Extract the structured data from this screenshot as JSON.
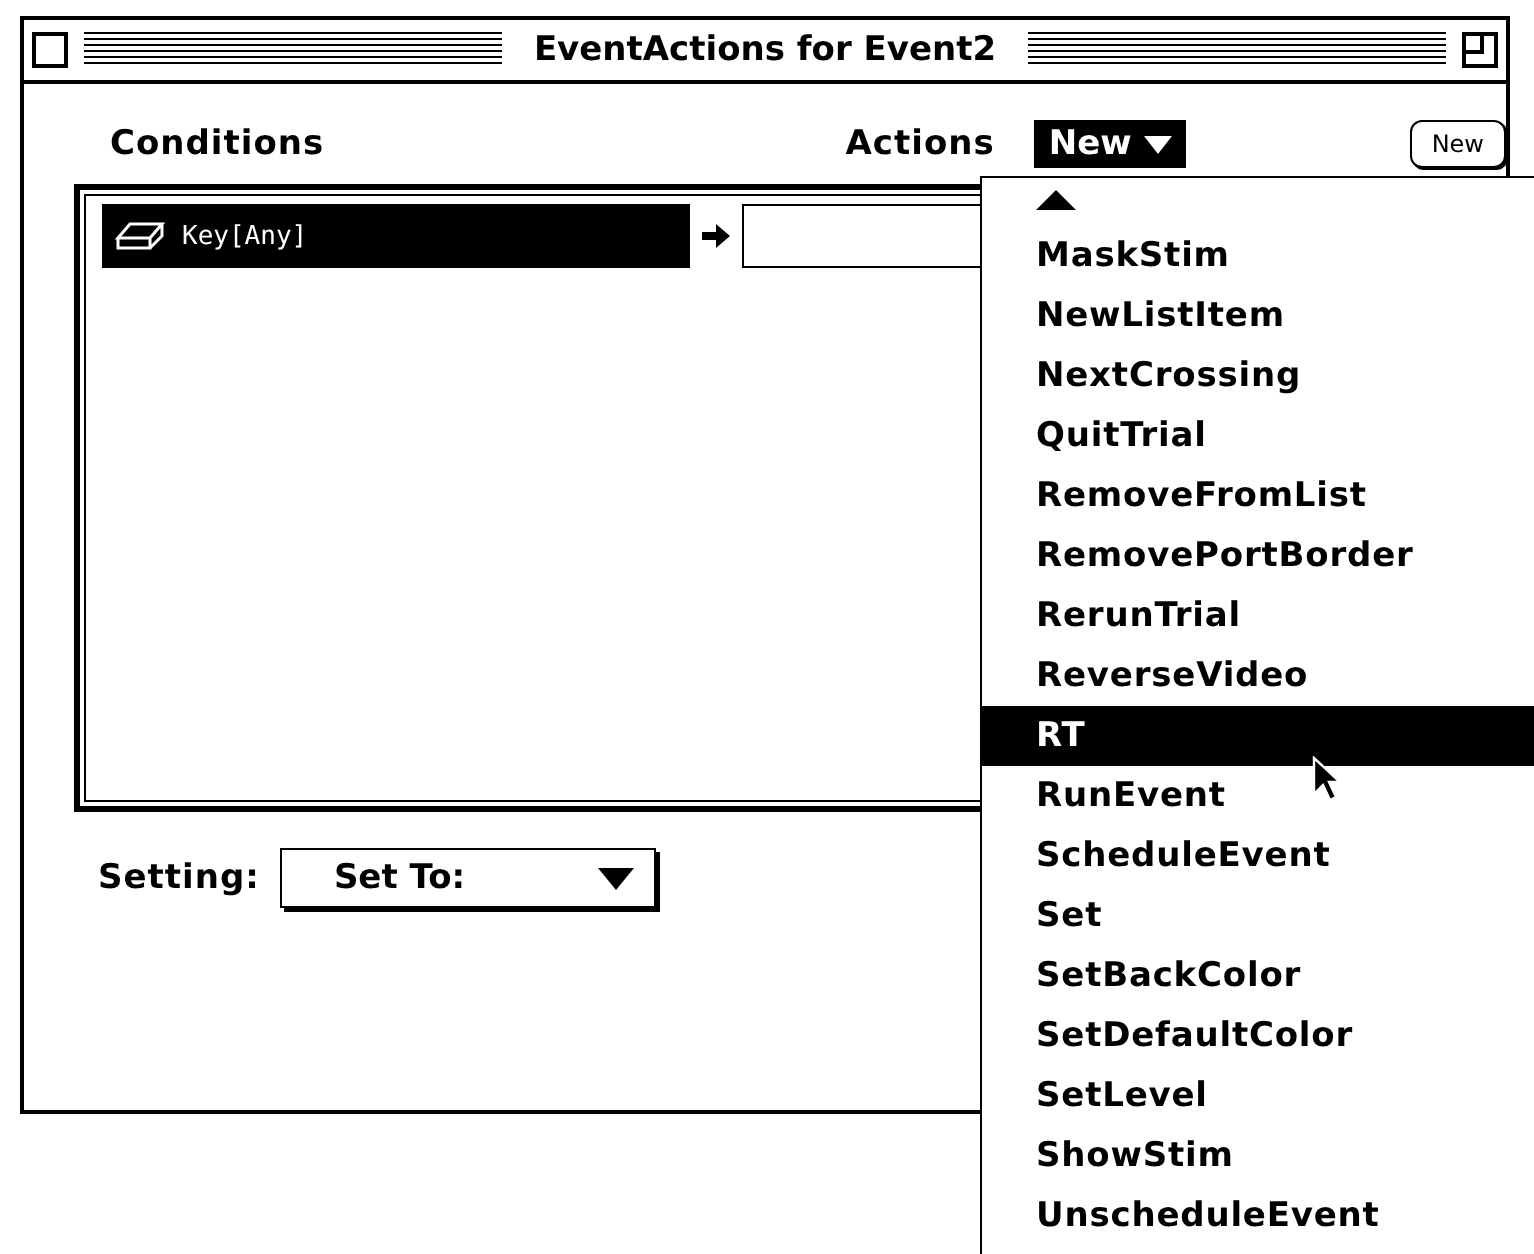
{
  "window": {
    "title": "EventActions for Event2"
  },
  "conditions_label": "Conditions",
  "actions_label": "Actions",
  "new_popup": {
    "label": "New",
    "open": true
  },
  "new_button": "New",
  "rows": [
    {
      "condition": "Key[Any]",
      "selected": true
    }
  ],
  "setting": {
    "label": "Setting:",
    "value": "Set To:"
  },
  "menu_items": [
    {
      "label": "MaskStim",
      "selected": false
    },
    {
      "label": "NewListItem",
      "selected": false
    },
    {
      "label": "NextCrossing",
      "selected": false
    },
    {
      "label": "QuitTrial",
      "selected": false
    },
    {
      "label": "RemoveFromList",
      "selected": false
    },
    {
      "label": "RemovePortBorder",
      "selected": false
    },
    {
      "label": "RerunTrial",
      "selected": false
    },
    {
      "label": "ReverseVideo",
      "selected": false
    },
    {
      "label": "RT",
      "selected": true
    },
    {
      "label": "RunEvent",
      "selected": false
    },
    {
      "label": "ScheduleEvent",
      "selected": false
    },
    {
      "label": "Set",
      "selected": false
    },
    {
      "label": "SetBackColor",
      "selected": false
    },
    {
      "label": "SetDefaultColor",
      "selected": false
    },
    {
      "label": "SetLevel",
      "selected": false
    },
    {
      "label": "ShowStim",
      "selected": false
    },
    {
      "label": "UnscheduleEvent",
      "selected": false
    }
  ]
}
